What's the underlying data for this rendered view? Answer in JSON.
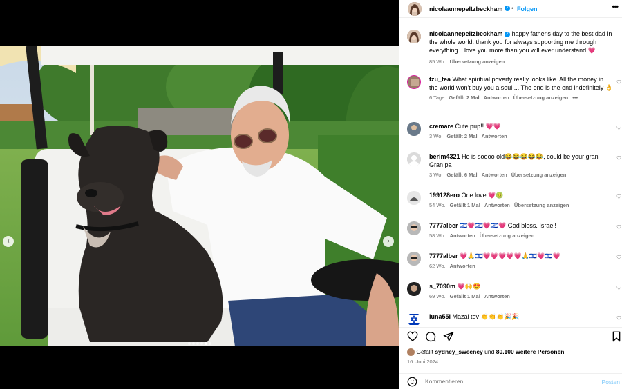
{
  "header": {
    "username": "nicolaannepeltzbeckham",
    "follow_label": "Folgen",
    "more_icon": "more-horizontal-icon"
  },
  "caption": {
    "username": "nicolaannepeltzbeckham",
    "text": "happy father's day to the best dad in the whole world. thank you for always supporting me through everything. i love you more than you will ever understand 💗",
    "time": "85 Wo.",
    "translate": "Übersetzung anzeigen"
  },
  "comments": [
    {
      "username": "tzu_tea",
      "text": "What spiritual poverty really looks like. All the money in the world won't buy you a soul ... The end is the end indefinitely 👌",
      "time": "6 Tage",
      "likes": "Gefällt 2 Mal",
      "reply": "Antworten",
      "translate": "Übersetzung anzeigen",
      "more": "•••"
    },
    {
      "username": "cremare",
      "text": "Cute pup!! 💗💗",
      "time": "3 Wo.",
      "likes": "Gefällt 2 Mal",
      "reply": "Antworten",
      "translate": "",
      "more": ""
    },
    {
      "username": "berim4321",
      "text": "He is soooo old😂😂😂😂😂, could be your gran Gran pa",
      "time": "3 Wo.",
      "likes": "Gefällt 6 Mal",
      "reply": "Antworten",
      "translate": "Übersetzung anzeigen",
      "more": ""
    },
    {
      "username": "199128ero",
      "text": "One love 💗🤢",
      "time": "54 Wo.",
      "likes": "Gefällt 1 Mal",
      "reply": "Antworten",
      "translate": "Übersetzung anzeigen",
      "more": ""
    },
    {
      "username": "7777alber",
      "text": "🇮🇱💗🇮🇱💗🇮🇱💗 God bless. Israel!",
      "time": "58 Wo.",
      "likes": "",
      "reply": "Antworten",
      "translate": "Übersetzung anzeigen",
      "more": ""
    },
    {
      "username": "7777alber",
      "text": "💗🙏🇮🇱💗💗💗💗💗🙏🇮🇱💗🇮🇱💗",
      "time": "62 Wo.",
      "likes": "",
      "reply": "Antworten",
      "translate": "",
      "more": ""
    },
    {
      "username": "s_7090m",
      "text": "💗🙌😍",
      "time": "69 Wo.",
      "likes": "Gefällt 1 Mal",
      "reply": "Antworten",
      "translate": "",
      "more": ""
    },
    {
      "username": "luna55i",
      "text": "Mazal tov 👏👏👏🎉🎉",
      "time": "",
      "likes": "",
      "reply": "",
      "translate": "",
      "more": ""
    }
  ],
  "likes": {
    "prefix": "Gefällt",
    "user": "sydney_sweeney",
    "middle": "und",
    "count": "80.100 weitere Personen"
  },
  "date": "16. Juni 2024",
  "add_comment": {
    "placeholder": "Kommentieren ...",
    "post_label": "Posten"
  },
  "colors": {
    "accent": "#0095f6",
    "heart": "#ed4956",
    "muted": "#737373"
  }
}
